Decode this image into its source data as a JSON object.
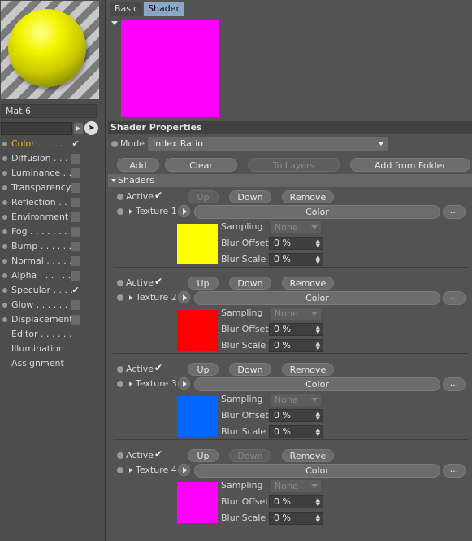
{
  "material": {
    "name": "Mat.6"
  },
  "channels": [
    {
      "label": "Color . . . . . .",
      "checked": true,
      "dot": true
    },
    {
      "label": "Diffusion . . . .",
      "checked": false,
      "dot": true
    },
    {
      "label": "Luminance . .",
      "checked": false,
      "dot": true
    },
    {
      "label": "Transparency",
      "checked": false,
      "dot": true
    },
    {
      "label": "Reflection . . .",
      "checked": false,
      "dot": true
    },
    {
      "label": "Environment",
      "checked": false,
      "dot": true
    },
    {
      "label": "Fog . . . . . . . .",
      "checked": false,
      "dot": true
    },
    {
      "label": "Bump . . . . . .",
      "checked": false,
      "dot": true
    },
    {
      "label": "Normal . . . . .",
      "checked": false,
      "dot": true
    },
    {
      "label": "Alpha . . . . . .",
      "checked": false,
      "dot": true
    },
    {
      "label": "Specular . . . .",
      "checked": true,
      "dot": true
    },
    {
      "label": "Glow . . . . . . .",
      "checked": false,
      "dot": true
    },
    {
      "label": "Displacement",
      "checked": false,
      "dot": true
    },
    {
      "label": "Editor . . . . . .",
      "checked": null,
      "dot": false
    },
    {
      "label": "Illumination",
      "checked": null,
      "dot": false
    },
    {
      "label": "Assignment",
      "checked": null,
      "dot": false
    }
  ],
  "tabs": [
    "Basic",
    "Shader"
  ],
  "preview_color": "#ff00ff",
  "shader_properties": {
    "title": "Shader Properties",
    "mode_label": "Mode",
    "mode_value": "Index Ratio",
    "buttons": {
      "add": "Add",
      "clear": "Clear",
      "to_layers": "To Layers",
      "add_from_folder": "Add from Folder"
    },
    "shaders_title": "Shaders"
  },
  "shaders": [
    {
      "active_label": "Active",
      "up": "Up",
      "up_enabled": false,
      "down": "Down",
      "down_enabled": true,
      "remove": "Remove",
      "texture_label": "Texture 1",
      "type": "Color",
      "more": "...",
      "swatch": "#ffff00",
      "sampling_label": "Sampling",
      "sampling_value": "None",
      "blur_offset_label": "Blur Offset",
      "blur_offset": "0 %",
      "blur_scale_label": "Blur Scale",
      "blur_scale": "0 %"
    },
    {
      "active_label": "Active",
      "up": "Up",
      "up_enabled": true,
      "down": "Down",
      "down_enabled": true,
      "remove": "Remove",
      "texture_label": "Texture 2",
      "type": "Color",
      "more": "...",
      "swatch": "#ff0000",
      "sampling_label": "Sampling",
      "sampling_value": "None",
      "blur_offset_label": "Blur Offset",
      "blur_offset": "0 %",
      "blur_scale_label": "Blur Scale",
      "blur_scale": "0 %"
    },
    {
      "active_label": "Active",
      "up": "Up",
      "up_enabled": true,
      "down": "Down",
      "down_enabled": true,
      "remove": "Remove",
      "texture_label": "Texture 3",
      "type": "Color",
      "more": "...",
      "swatch": "#0066ff",
      "sampling_label": "Sampling",
      "sampling_value": "None",
      "blur_offset_label": "Blur Offset",
      "blur_offset": "0 %",
      "blur_scale_label": "Blur Scale",
      "blur_scale": "0 %"
    },
    {
      "active_label": "Active",
      "up": "Up",
      "up_enabled": true,
      "down": "Down",
      "down_enabled": false,
      "remove": "Remove",
      "texture_label": "Texture 4",
      "type": "Color",
      "more": "...",
      "swatch": "#ff00ff",
      "sampling_label": "Sampling",
      "sampling_value": "None",
      "blur_offset_label": "Blur Offset",
      "blur_offset": "0 %",
      "blur_scale_label": "Blur Scale",
      "blur_scale": "0 %"
    }
  ]
}
